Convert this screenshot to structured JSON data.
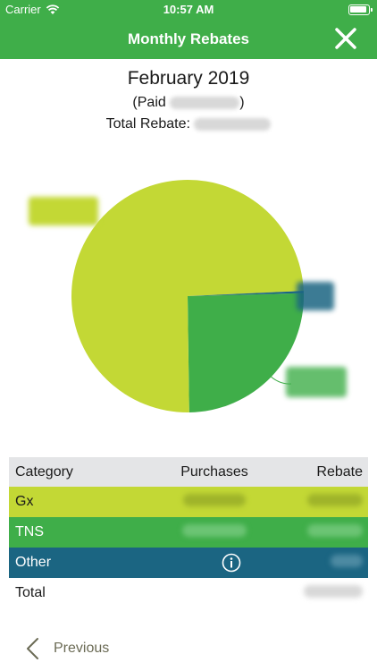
{
  "status_bar": {
    "carrier": "Carrier",
    "time": "10:57 AM"
  },
  "nav": {
    "title": "Monthly Rebates",
    "close_icon": "close-icon"
  },
  "header": {
    "month": "February 2019",
    "paid_prefix": "(Paid",
    "paid_suffix": ")",
    "total_label": "Total Rebate:"
  },
  "colors": {
    "green": "#3fae49",
    "lime": "#c3d835",
    "teal": "#1b6582",
    "header_gray": "#e4e5e7"
  },
  "chart_data": {
    "type": "pie",
    "categories": [
      "Gx",
      "TNS",
      "Other"
    ],
    "values": [
      74.5,
      25.2,
      0.3
    ],
    "colors": [
      "#c3d835",
      "#3fae49",
      "#1b6582"
    ]
  },
  "table": {
    "headers": {
      "category": "Category",
      "purchases": "Purchases",
      "rebate": "Rebate"
    },
    "rows": [
      {
        "category": "Gx"
      },
      {
        "category": "TNS"
      },
      {
        "category": "Other"
      },
      {
        "category": "Total"
      }
    ]
  },
  "footer": {
    "previous_label": "Previous"
  }
}
